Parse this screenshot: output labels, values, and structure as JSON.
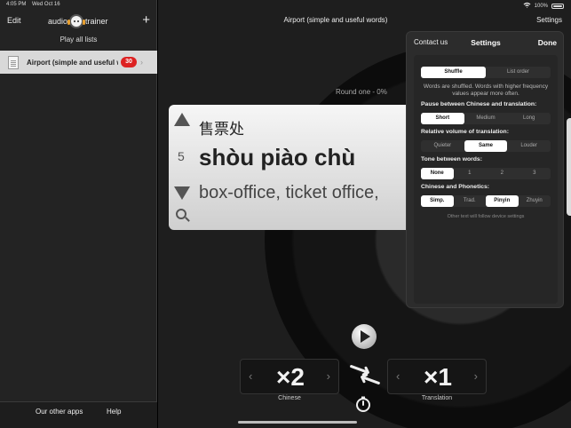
{
  "status": {
    "time": "4:05 PM",
    "date": "Wed Oct 16",
    "battery": "100%"
  },
  "sidebar": {
    "edit_label": "Edit",
    "logo_left": "audio",
    "logo_right": "trainer",
    "add_label": "+",
    "play_all_label": "Play all lists",
    "list_item": {
      "title": "Airport  (simple and useful words)",
      "count": "30"
    },
    "footer": {
      "other_apps": "Our other apps",
      "help": "Help"
    }
  },
  "main": {
    "title": "Airport  (simple and useful words)",
    "settings_label": "Settings",
    "round_label": "Round one - 0%",
    "card": {
      "number": "5",
      "hanzi": "售票处",
      "pinyin": "shòu piào chù",
      "translation": "box-office, ticket office, "
    },
    "chinese_stepper": {
      "value": "×2",
      "label": "Chinese"
    },
    "translation_stepper": {
      "value": "×1",
      "label": "Translation"
    }
  },
  "popover": {
    "contact_label": "Contact us",
    "title": "Settings",
    "done_label": "Done",
    "order": {
      "options": [
        "Shuffle",
        "List order"
      ],
      "selected": 0
    },
    "order_note": "Words are shuffled. Words with higher frequency values appear more often.",
    "pause": {
      "title": "Pause between Chinese and translation:",
      "options": [
        "Short",
        "Medium",
        "Long"
      ],
      "selected": 0
    },
    "volume": {
      "title": "Relative volume of translation:",
      "options": [
        "Quieter",
        "Same",
        "Louder"
      ],
      "selected": 1
    },
    "tone": {
      "title": "Tone between words:",
      "options": [
        "None",
        "1",
        "2",
        "3"
      ],
      "selected": 0
    },
    "phonetics": {
      "title": "Chinese and Phonetics:",
      "options": [
        "Simp.",
        "Trad.",
        "Pinyin",
        "Zhuyin"
      ],
      "selected": [
        0,
        2
      ]
    },
    "foot_note": "Other text will follow device settings"
  },
  "colors": {
    "badge": "#dd2222",
    "card_bg": "#e6e6e6",
    "disc_accent": "#6b1212"
  }
}
